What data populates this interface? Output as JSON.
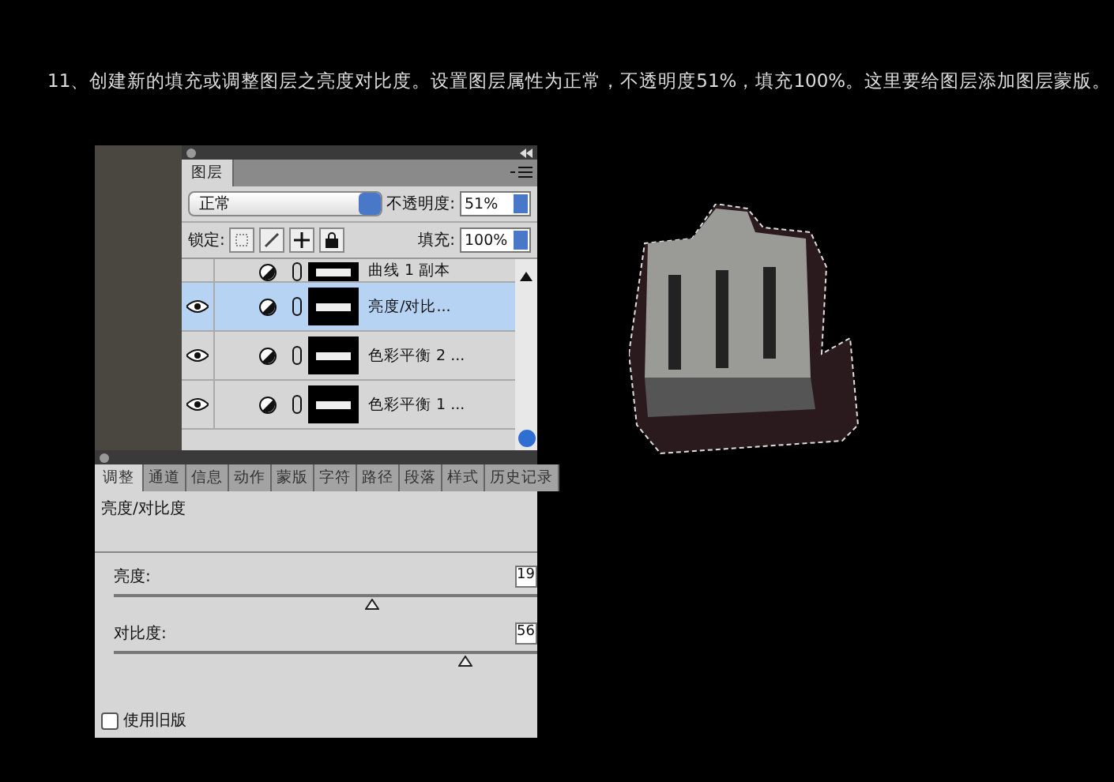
{
  "heading": "11、创建新的填充或调整图层之亮度对比度。设置图层属性为正常，不透明度51%，填充100%。这里要给图层添加图层蒙版。",
  "layers_panel": {
    "tabs": [
      {
        "label": "图层",
        "selected": true
      }
    ],
    "blend_mode": "正常",
    "opacity_label": "不透明度:",
    "opacity": "51%",
    "lock_label": "锁定:",
    "fill_label": "填充:",
    "fill": "100%",
    "layers": [
      {
        "name": "曲线 1 副本",
        "visible": false,
        "selected": false
      },
      {
        "name": "亮度/对比...",
        "visible": true,
        "selected": true
      },
      {
        "name": "色彩平衡 2 ...",
        "visible": true,
        "selected": false
      },
      {
        "name": "色彩平衡 1 ...",
        "visible": true,
        "selected": false
      }
    ]
  },
  "adjust_panel": {
    "tabs": [
      {
        "label": "调整",
        "selected": true
      },
      {
        "label": "通道",
        "selected": false
      },
      {
        "label": "信息",
        "selected": false
      },
      {
        "label": "动作",
        "selected": false
      },
      {
        "label": "蒙版",
        "selected": false
      },
      {
        "label": "字符",
        "selected": false
      },
      {
        "label": "路径",
        "selected": false
      },
      {
        "label": "段落",
        "selected": false
      },
      {
        "label": "样式",
        "selected": false
      },
      {
        "label": "历史记录",
        "selected": false
      }
    ],
    "title": "亮度/对比度",
    "sliders": [
      {
        "label": "亮度:",
        "value": "19",
        "level": 0.61
      },
      {
        "label": "对比度:",
        "value": "56",
        "level": 0.83
      }
    ],
    "legacy": {
      "label": "使用旧版",
      "checked": false
    }
  }
}
